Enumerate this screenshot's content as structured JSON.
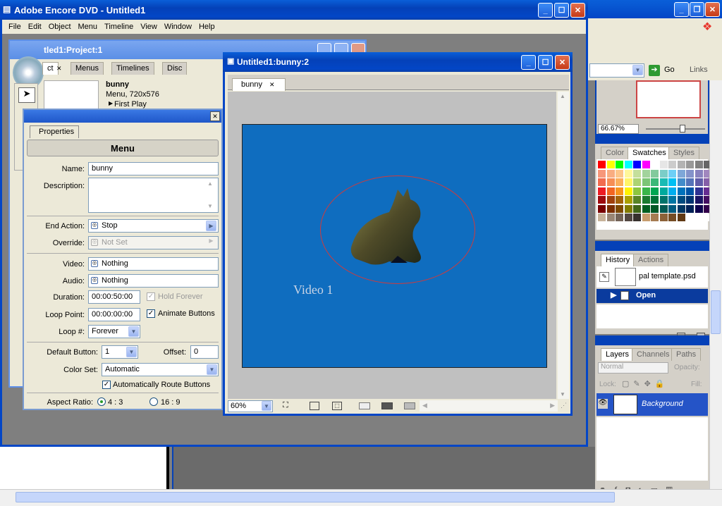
{
  "main_window": {
    "title": "Adobe Encore DVD - Untitled1",
    "menu": [
      "File",
      "Edit",
      "Object",
      "Menu",
      "Timeline",
      "View",
      "Window",
      "Help"
    ]
  },
  "project_window": {
    "title": "tled1:Project:1",
    "tabs": [
      "ct",
      "Menus",
      "Timelines",
      "Disc"
    ],
    "item_name": "bunny",
    "item_type": "Menu, 720x576",
    "item_first_play": "First Play"
  },
  "properties": {
    "tab": "Properties",
    "heading": "Menu",
    "name_label": "Name:",
    "name_value": "bunny",
    "description_label": "Description:",
    "end_action_label": "End Action:",
    "end_action_value": "Stop",
    "override_label": "Override:",
    "override_value": "Not Set",
    "video_label": "Video:",
    "video_value": "Nothing",
    "audio_label": "Audio:",
    "audio_value": "Nothing",
    "duration_label": "Duration:",
    "duration_value": "00:00:50:00",
    "hold_forever": "Hold Forever",
    "loop_point_label": "Loop Point:",
    "loop_point_value": "00:00:00:00",
    "animate_buttons": "Animate Buttons",
    "loop_label": "Loop #:",
    "loop_value": "Forever",
    "default_button_label": "Default Button:",
    "default_button_value": "1",
    "offset_label": "Offset:",
    "offset_value": "0",
    "color_set_label": "Color Set:",
    "color_set_value": "Automatic",
    "auto_route": "Automatically Route Buttons",
    "aspect_label": "Aspect Ratio:",
    "aspect_4_3": "4 : 3",
    "aspect_16_9": "16 : 9"
  },
  "bunny_window": {
    "title": "Untitled1:bunny:2",
    "tab": "bunny",
    "canvas_text": "Video 1",
    "zoom": "60%",
    "canvas_color": "#0f6dbf"
  },
  "right_panels": {
    "go_label": "Go",
    "links_label": "Links",
    "navigator_zoom": "66.67%",
    "color_tabs": [
      "Color",
      "Swatches",
      "Styles"
    ],
    "history_tabs": [
      "History",
      "Actions"
    ],
    "history_snapshot": "pal template.psd",
    "history_state": "Open",
    "layer_tabs": [
      "Layers",
      "Channels",
      "Paths"
    ],
    "blend_mode": "Normal",
    "opacity_label": "Opacity:",
    "lock_label": "Lock:",
    "fill_label": "Fill:",
    "layer_name": "Background"
  }
}
